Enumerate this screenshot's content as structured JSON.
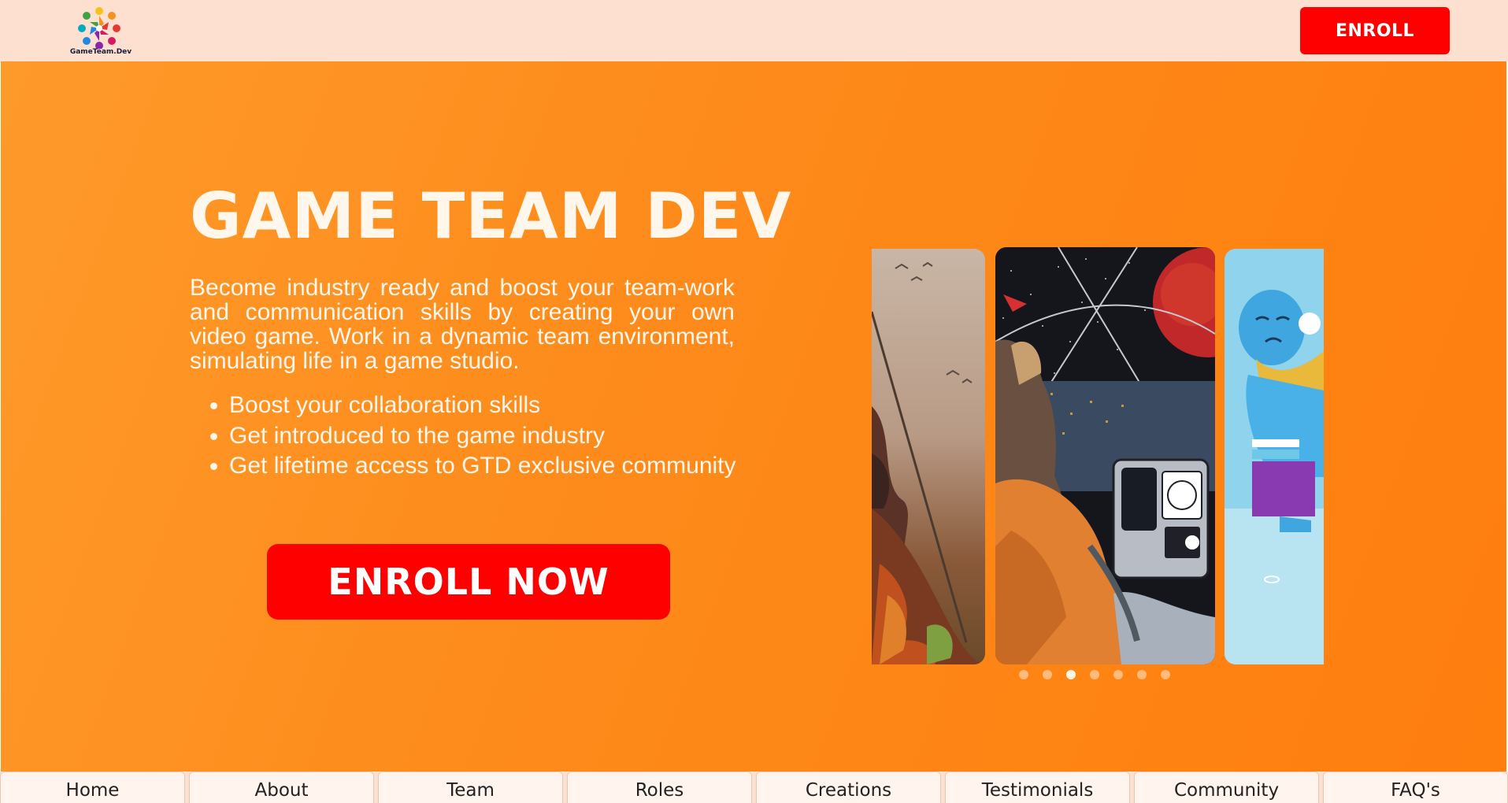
{
  "header": {
    "logo_text": "GameTeam.Dev",
    "enroll_label": "ENROLL"
  },
  "hero": {
    "title": "GAME TEAM DEV",
    "description": "Become industry ready and boost your team-work and communication skills by creating your own video game. Work in a dynamic team environment, simulating life in a game studio.",
    "bullets": [
      "Boost your collaboration skills",
      "Get introduced to the game industry",
      "Get lifetime access to GTD exclusive community"
    ],
    "cta_label": "ENROLL NOW"
  },
  "carousel": {
    "slide_count": 7,
    "active_index": 2
  },
  "nav": {
    "items": [
      "Home",
      "About",
      "Team",
      "Roles",
      "Creations",
      "Testimonials",
      "Community",
      "FAQ's"
    ]
  },
  "colors": {
    "topbar": "#fde0d0",
    "hero_orange": "#fd8a1a",
    "enroll_red": "#ff0000",
    "hero_text": "#fff6ec"
  }
}
